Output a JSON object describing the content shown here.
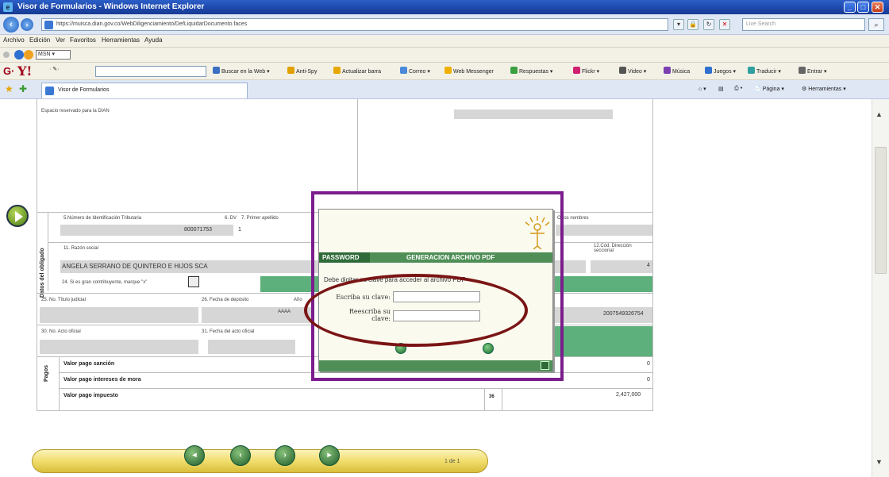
{
  "window": {
    "title": "Visor de Formularios - Windows Internet Explorer",
    "buttons": [
      "_",
      "□",
      "✕"
    ]
  },
  "address": {
    "url": "https://muisca.dian.gov.co/WebDiligenciamiento/DefLiquidarDocumento.faces",
    "search_placeholder": "Live Search"
  },
  "menu": [
    "Archivo",
    "Edición",
    "Ver",
    "Favoritos",
    "Herramientas",
    "Ayuda"
  ],
  "links": {
    "msn_label": "MSN"
  },
  "yahoo": {
    "items": [
      {
        "label": "Buscar en la Web",
        "color": "#3b6fc2"
      },
      {
        "label": "Anti-Spy",
        "color": "#e0a000"
      },
      {
        "label": "Actualizar barra",
        "color": "#e6a800"
      },
      {
        "label": "Correo",
        "color": "#4a8ad8"
      },
      {
        "label": "Web Messenger",
        "color": "#f0b000"
      },
      {
        "label": "Respuestas",
        "color": "#3aa040"
      },
      {
        "label": "Flickr",
        "color": "#d02070"
      },
      {
        "label": "Video",
        "color": "#555"
      },
      {
        "label": "Música",
        "color": "#7b3fb0"
      },
      {
        "label": "Juegos",
        "color": "#3070d0"
      },
      {
        "label": "Traducir",
        "color": "#30a0a0"
      },
      {
        "label": "Entrar",
        "color": "#666"
      }
    ]
  },
  "tab": {
    "label": "Visor de Formularios"
  },
  "right_tools": {
    "page": "Página",
    "tools": "Herramientas"
  },
  "form": {
    "top_left_text": "Espacio reservado para la DIAN",
    "f5_label": "5.Número de Identificación Tributaria",
    "f6_label": "6. DV",
    "f7_label": "7. Primer apellido",
    "f10_label": "Otros nombres",
    "nit": "800071753",
    "dv": "1",
    "f11_label": "11. Razón social",
    "f12_label": "12.Cód. Dirección seccional",
    "razon_social": "ANGELA SERRANO DE QUINTERO E HIJOS SCA",
    "cod_seccional": "4",
    "f24_label": "24. Si es gran contribuyente, marque \"x\"",
    "section_label": "Datos del obligado",
    "f25_label": "25. No. Título judicial",
    "f26_label": "26. Fecha de depósito",
    "year_label": "Año",
    "year_val": "AAAA",
    "number_right": "2007549326754",
    "f30_label": "30. No. Acto oficial",
    "f31_label": "31. Fecha del acto oficial",
    "pagos_label": "Pagos",
    "pagos": [
      {
        "label": "Valor pago sanción",
        "num": "",
        "value": "0"
      },
      {
        "label": "Valor pago intereses de mora",
        "num": "",
        "value": "0"
      },
      {
        "label": "Valor pago impuesto",
        "num": "36",
        "value": "2,427,000"
      }
    ]
  },
  "dialog": {
    "password_tab": "PASSWORD",
    "header_title": "GENERACION ARCHIVO PDF",
    "message": "Debe digitar su clave para acceder al archivo PDF",
    "label1": "Escriba su clave:",
    "label2a": "Reescriba su",
    "label2b": "clave:"
  },
  "pager": {
    "page_indicator": "1 de 1"
  }
}
